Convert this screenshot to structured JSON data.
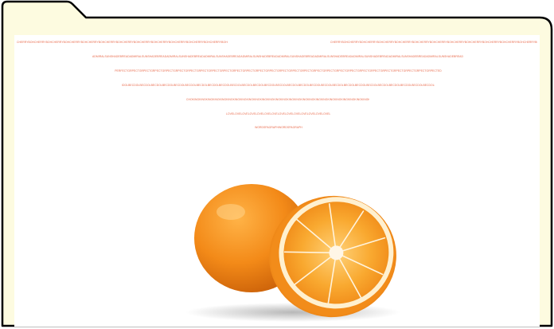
{
  "text_lines": {
    "line_1a": "CHERRYBOHCHERRYBOHCHERRYBOHCHERRYBOHCHERRYBOHCHERRYBOHCHERRYBOHCHERRYBOHCHERRYBOHCHERRYBOHCHERRYBOHCHERRYBOHCHERRYBOHCHERRYBOHCHERRYBOH",
    "line_1b": "CHERRYBOHCHERRYBOHCHERRYBOHCHERRYBOHCHERRYBOHCHERRYBOHCHERRYBOHCHERRYBOHCHERRYBOHCHERRYBOHCHERRYBOHCHERRYBOHCHERRYBOHCHERRYBOHCHERRYBOH",
    "line_2": "ADMIRALSUNSHADEBREADADMIRALSUNSHADEBREADADMIRALSUNSHADEBREADADMIRALSUNSHADEBREADADMIRALSUNSHADEBREADADMIRALSUNSHADEBREADADMIRALSUNSHADEBREADADMIRALSUNSHADEBREADADMIRALSUNSHADEBREADADMIRALSUNSHADEBREAD",
    "line_3": "PERFECTGRPECTGRPECTGRPECTGRPECTGRPECTGRPECTGRPECTGRPECTGRPECTGRPECTGRPECTGRPECTGRPECTGRPECTGRPECTGRPECTGRPECTGRPECTGRPECTGRPECTGRPECTGRPECTGRPECTGRPECTGRPECTGRPECTGRPECTED",
    "line_4": "IDOLBECDOLBECDOLBECDOLBECDOLBECDOLBECDOLBECDOLBECDOLBECDOLBECDOLBECDOLBECDOLBECDOLBECDOLBECDOLBECDOLBECDOLBECDOLBECDOLBECDOLBECDOLBECDOLBECDOLBECDOLBECDOLBECDOLBECDOLBECDOLBECDOLBECDOLBECDOLBEDIE",
    "line_5": "CHOKINGKINGKINGKINGKINGKINGKINGKINGKINGKINGKINGKINGKINGKINGKINGKINGKINGKINGKINGKINGKINGKINGKINGKINGKINGKINGKINGKINGKINGKINGDY",
    "line_6": "LOVELOVELOVELOVELOVELOVELOVELOVELOVELOVELOVELOVELOVELOVELOVELOVE",
    "line_7": "WORDSPAGRAPHWORDSPAGRAPH"
  },
  "colors": {
    "folder_fill": "#fdfbe0",
    "folder_outline": "#000000",
    "text_orange": "#e8694a",
    "orange_peel": "#f08a1c",
    "orange_pulp": "#f6a62a",
    "orange_pith": "#fff2d8"
  },
  "icons": [
    "folder-icon"
  ]
}
